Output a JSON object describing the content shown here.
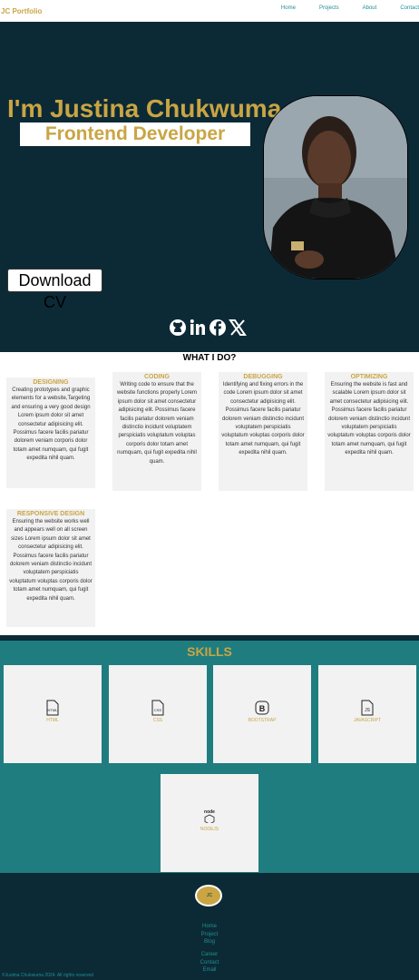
{
  "nav": {
    "brand": "JC Portfolio",
    "links": [
      "Home",
      "Projects",
      "About",
      "Contact"
    ]
  },
  "hero": {
    "name": "I'm Justina Chukwuma",
    "role": "Frontend Developer",
    "download_label": "Download CV",
    "socials": [
      "github-icon",
      "linkedin-icon",
      "facebook-icon",
      "x-icon"
    ]
  },
  "services": {
    "title": "WHAT I DO?",
    "cards": [
      {
        "title": "DESIGNING",
        "text": "Creating prototypes and graphic elements for a website,Targeting and ensuring a very good design Lorem ipsum dolor sit amet consectetur adipisicing elit. Possimus facere facilis pariatur dolorem veniam corporis dolor totam amet numquam, qui fugit expedita nihil quam."
      },
      {
        "title": "CODING",
        "text": "Writing code to ensure that the website functions properly Lorem ipsum dolor sit amet consectetur adipisicing elit. Possimus facere facilis pariatur dolorem veniam distinctio incidunt voluptatem perspiciatis voluptatum voluptas corporis dolor totam amet numquam, qui fugit expedita nihil quam."
      },
      {
        "title": "DEBUGGING",
        "text": "Identifying and fixing errors in the code Lorem ipsum dolor sit amet consectetur adipisicing elit. Possimus facere facilis pariatur dolorem veniam distinctio incidunt voluptatem perspiciatis voluptatum voluptas corporis dolor totam amet numquam, qui fugit expedita nihil quam."
      },
      {
        "title": "OPTIMIZING",
        "text": "Ensuring the website is fast and scalable Lorem ipsum dolor sit amet consectetur adipisicing elit. Possimus facere facilis pariatur dolorem veniam distinctio incidunt voluptatem perspiciatis voluptatum voluptas corporis dolor totam amet numquam, qui fugit expedita nihil quam."
      },
      {
        "title": "RESPONSIVE DESIGN",
        "text": "Ensuring the website works well and appears well on all screen sizes Lorem ipsum dolor sit amet consectetur adipisicing elit. Possimus facere facilis pariatur dolorem veniam distinctio incidunt voluptatem perspiciatis voluptatum voluptas corporis dolor totam amet numquam, qui fugit expedita nihil quam."
      }
    ]
  },
  "skills": {
    "title": "SKILLS",
    "items": [
      {
        "label": "HTML",
        "icon": "html-file-icon",
        "glyph": "HTML"
      },
      {
        "label": "CSS",
        "icon": "css-file-icon",
        "glyph": "CSS"
      },
      {
        "label": "BOOTSTRAP",
        "icon": "bootstrap-icon",
        "glyph": "B"
      },
      {
        "label": "JAVASCRIPT",
        "icon": "js-file-icon",
        "glyph": "JS"
      },
      {
        "label": "NODEJS",
        "icon": "nodejs-icon",
        "glyph": "node"
      }
    ]
  },
  "footer": {
    "logo": "JC",
    "links_a": [
      "Home",
      "Project",
      "Blog"
    ],
    "links_b": [
      "Career",
      "Contact",
      "Email"
    ],
    "copyright": "©Justina Chukwuma 2024. All rights reserved"
  },
  "colors": {
    "dark": "#0c2a35",
    "gold": "#c9a544",
    "teal": "#1f7d7f",
    "link": "#1f8f94"
  }
}
